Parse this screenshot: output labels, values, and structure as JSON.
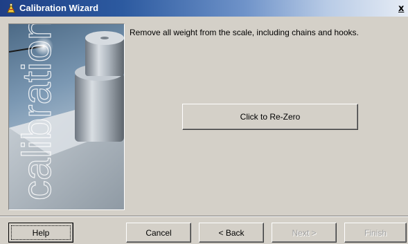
{
  "window": {
    "title": "Calibration Wizard",
    "close_label": "x",
    "title_icon": "wizard-icon"
  },
  "side_panel": {
    "image": "calibration-weight-image",
    "watermark_text": "calibration"
  },
  "content": {
    "instruction": "Remove all weight from the scale, including chains and hooks.",
    "rezero_label": "Click to Re-Zero"
  },
  "buttons": {
    "help": "Help",
    "cancel": "Cancel",
    "back": "< Back",
    "next": "Next >",
    "finish": "Finish"
  },
  "colors": {
    "titlebar_start": "#1f3f86",
    "titlebar_end": "#e6ecf5",
    "face": "#d4d0c8"
  }
}
